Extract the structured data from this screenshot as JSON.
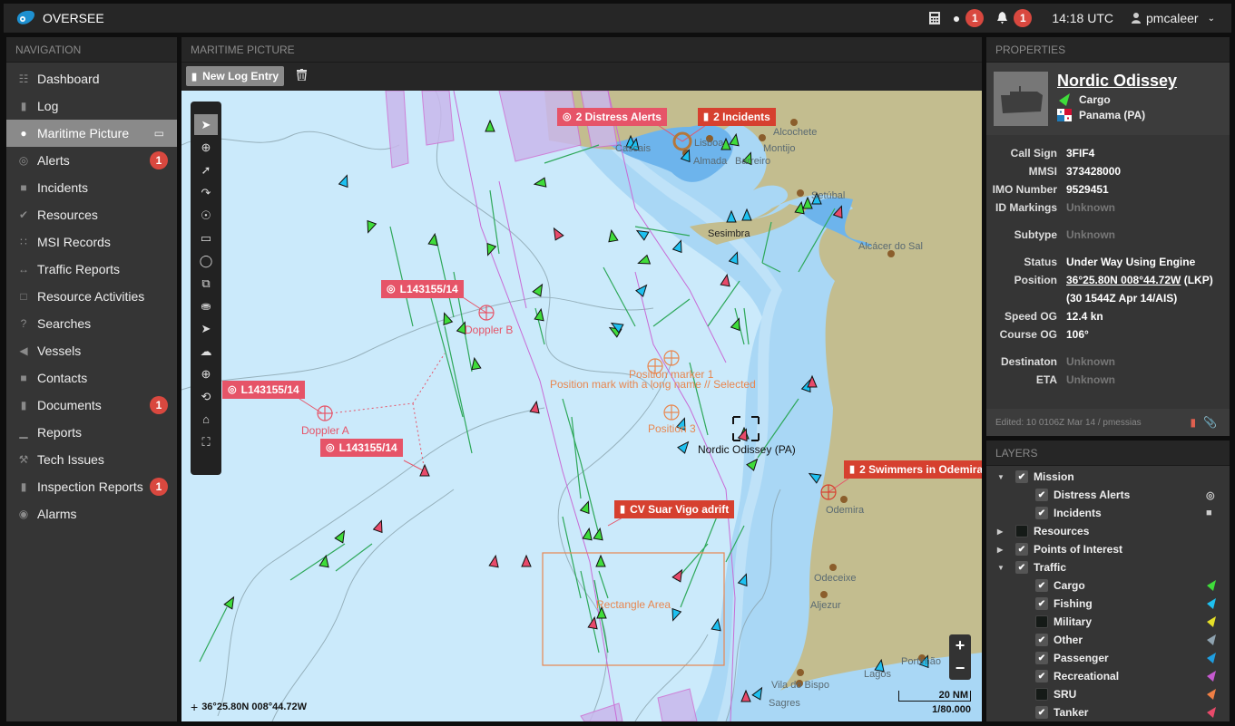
{
  "app": {
    "title": "OVERSEE"
  },
  "header": {
    "calculator_icon": "calculator-icon",
    "messages_count": "1",
    "alerts_count": "1",
    "time": "14:18 UTC",
    "user": "pmcaleer"
  },
  "navigation": {
    "title": "NAVIGATION",
    "items": [
      {
        "label": "Dashboard",
        "icon": "grid-icon"
      },
      {
        "label": "Log",
        "icon": "book-icon"
      },
      {
        "label": "Maritime Picture",
        "icon": "globe-icon",
        "active": true
      },
      {
        "label": "Alerts",
        "icon": "target-icon",
        "badge": "1"
      },
      {
        "label": "Incidents",
        "icon": "folder-alert-icon"
      },
      {
        "label": "Resources",
        "icon": "check-circle-icon"
      },
      {
        "label": "MSI Records",
        "icon": "rss-icon"
      },
      {
        "label": "Traffic Reports",
        "icon": "arrows-h-icon"
      },
      {
        "label": "Resource Activities",
        "icon": "calendar-icon"
      },
      {
        "label": "Searches",
        "icon": "search-question-icon"
      },
      {
        "label": "Vessels",
        "icon": "vessel-icon"
      },
      {
        "label": "Contacts",
        "icon": "phone-icon"
      },
      {
        "label": "Documents",
        "icon": "document-icon",
        "badge": "1"
      },
      {
        "label": "Reports",
        "icon": "bar-chart-icon"
      },
      {
        "label": "Tech Issues",
        "icon": "wrench-icon"
      },
      {
        "label": "Inspection Reports",
        "icon": "inspection-icon",
        "badge": "1"
      },
      {
        "label": "Alarms",
        "icon": "alarm-icon"
      }
    ]
  },
  "main": {
    "title": "MARITIME PICTURE",
    "new_log_entry": "New Log Entry",
    "map": {
      "labels": {
        "distress_alerts": "2 Distress Alerts",
        "incidents": "2 Incidents",
        "log1": "L143155/14",
        "log2": "L143155/14",
        "log3": "L143155/14",
        "cv_suar": "CV Suar Vigo adrift",
        "swimmers": "2 Swimmers in Odemira"
      },
      "places": {
        "cascais": "Cascais",
        "lisboa": "Lisboa",
        "almada": "Almada",
        "barreiro": "Barreiro",
        "alcochete": "Alcochete",
        "montijo": "Montijo",
        "setubal": "Setúbal",
        "sesimbra": "Sesimbra",
        "alcacer": "Alcácer do Sal",
        "odemira": "Odemira",
        "odeceixe": "Odeceixe",
        "aljezur": "Aljezur",
        "vila_do_bispo": "Vila do Bispo",
        "sagres": "Sagres",
        "lagos": "Lagos",
        "portimao": "Portimão"
      },
      "markers": {
        "doppler_a": "Doppler A",
        "doppler_b": "Doppler B",
        "pos1": "Position marker 1",
        "pos2": "Position mark with a long name // Selected",
        "pos3": "Position 3",
        "rect": "Rectangle Area",
        "selected_vessel": "Nordic Odissey (PA)"
      },
      "coords": "36°25.80N 008°44.72W",
      "scale": "20 NM",
      "ratio": "1/80.000",
      "zoom_in": "+",
      "zoom_out": "−"
    }
  },
  "properties": {
    "title": "PROPERTIES",
    "vessel_name": "Nordic Odissey",
    "type": "Cargo",
    "flag": "Panama (PA)",
    "fields": {
      "call_sign": {
        "label": "Call Sign",
        "value": "3FIF4"
      },
      "mmsi": {
        "label": "MMSI",
        "value": "373428000"
      },
      "imo": {
        "label": "IMO Number",
        "value": "9529451"
      },
      "id_markings": {
        "label": "ID Markings",
        "value": "Unknown"
      },
      "subtype": {
        "label": "Subtype",
        "value": "Unknown"
      },
      "status": {
        "label": "Status",
        "value": "Under Way Using Engine"
      },
      "position": {
        "label": "Position",
        "value": "36°25.80N 008°44.72W",
        "suffix": "(LKP)",
        "line2": "(30 1544Z Apr 14/AIS)"
      },
      "speed": {
        "label": "Speed OG",
        "value": "12.4 kn"
      },
      "course": {
        "label": "Course OG",
        "value": "106°"
      },
      "destination": {
        "label": "Destinaton",
        "value": "Unknown"
      },
      "eta": {
        "label": "ETA",
        "value": "Unknown"
      }
    },
    "edited": "Edited: 10 0106Z Mar 14 / pmessias"
  },
  "layers": {
    "title": "LAYERS",
    "items": [
      {
        "label": "Mission",
        "checked": true,
        "expanded": true,
        "level": 0
      },
      {
        "label": "Distress Alerts",
        "checked": true,
        "level": 1,
        "symbol": "target"
      },
      {
        "label": "Incidents",
        "checked": true,
        "level": 1,
        "symbol": "folder"
      },
      {
        "label": "Resources",
        "checked": false,
        "expanded": false,
        "level": 0
      },
      {
        "label": "Points of Interest",
        "checked": true,
        "expanded": false,
        "level": 0
      },
      {
        "label": "Traffic",
        "checked": true,
        "expanded": true,
        "level": 0
      },
      {
        "label": "Cargo",
        "checked": true,
        "level": 1,
        "color": "#3fdc3a"
      },
      {
        "label": "Fishing",
        "checked": true,
        "level": 1,
        "color": "#1ec0f0"
      },
      {
        "label": "Military",
        "checked": false,
        "level": 1,
        "color": "#e6e028"
      },
      {
        "label": "Other",
        "checked": true,
        "level": 1,
        "color": "#8fa3b0"
      },
      {
        "label": "Passenger",
        "checked": true,
        "level": 1,
        "color": "#1f9ee0"
      },
      {
        "label": "Recreational",
        "checked": true,
        "level": 1,
        "color": "#c65ad0"
      },
      {
        "label": "SRU",
        "checked": false,
        "level": 1,
        "color": "#ef7f45"
      },
      {
        "label": "Tanker",
        "checked": true,
        "level": 1,
        "color": "#e84a6a"
      }
    ]
  }
}
